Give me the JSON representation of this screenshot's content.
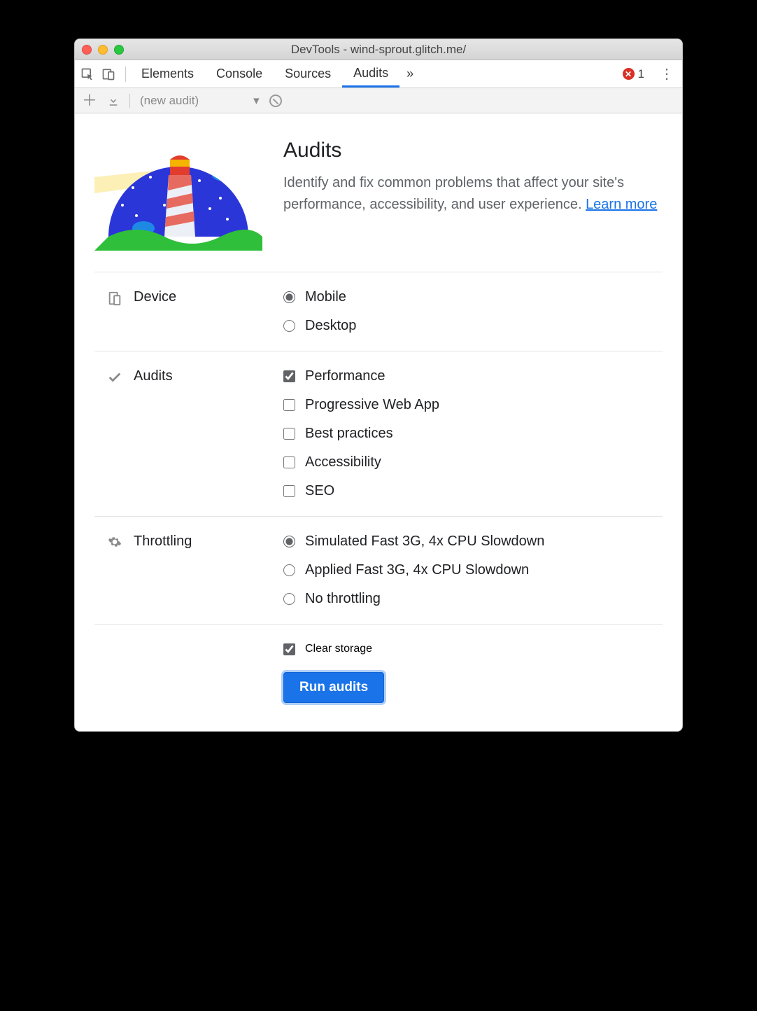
{
  "window": {
    "title": "DevTools - wind-sprout.glitch.me/"
  },
  "tabs": {
    "items": [
      "Elements",
      "Console",
      "Sources",
      "Audits"
    ],
    "active_index": 3,
    "overflow_glyph": "»",
    "error_count": "1"
  },
  "toolbar": {
    "new_audit_label": "(new audit)"
  },
  "hero": {
    "title": "Audits",
    "blurb": "Identify and fix common problems that affect your site's performance, accessibility, and user experience. ",
    "learn_more": "Learn more"
  },
  "device": {
    "label": "Device",
    "options": [
      {
        "label": "Mobile",
        "checked": true
      },
      {
        "label": "Desktop",
        "checked": false
      }
    ]
  },
  "audits": {
    "label": "Audits",
    "options": [
      {
        "label": "Performance",
        "checked": true
      },
      {
        "label": "Progressive Web App",
        "checked": false
      },
      {
        "label": "Best practices",
        "checked": false
      },
      {
        "label": "Accessibility",
        "checked": false
      },
      {
        "label": "SEO",
        "checked": false
      }
    ]
  },
  "throttling": {
    "label": "Throttling",
    "options": [
      {
        "label": "Simulated Fast 3G, 4x CPU Slowdown",
        "checked": true
      },
      {
        "label": "Applied Fast 3G, 4x CPU Slowdown",
        "checked": false
      },
      {
        "label": "No throttling",
        "checked": false
      }
    ]
  },
  "clear_storage": {
    "label": "Clear storage",
    "checked": true
  },
  "run_button": "Run audits"
}
